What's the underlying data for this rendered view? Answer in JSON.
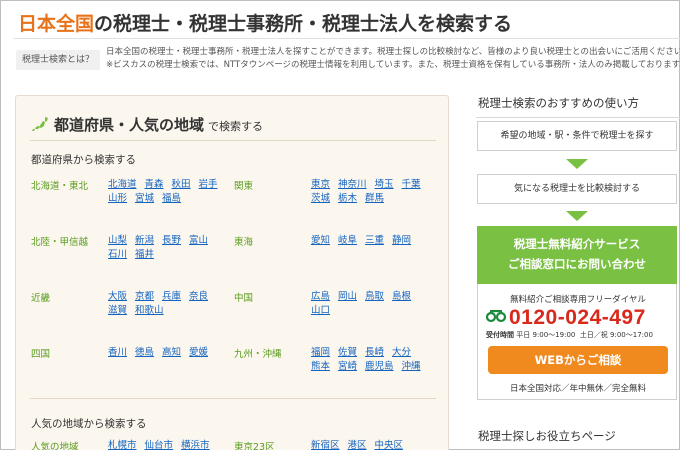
{
  "page": {
    "title_accent": "日本全国",
    "title_rest": "の税理士・税理士事務所・税理士法人を検索する"
  },
  "intro": {
    "badge": "税理士検索とは？",
    "line1": "日本全国の税理士・税理士事務所・税理士法人を探すことができます。税理士探しの比較検討など、皆様のより良い税理士との出会いにご活用くださいませ。",
    "line2": "※ビスカスの税理士検索では、NTTタウンページの税理士情報を利用しています。また、税理士資格を保有している事務所・法人のみ掲載しております。"
  },
  "search": {
    "title": "都道府県・人気の地域",
    "title_suffix": "で検索する",
    "pref_heading": "都道府県から検索する",
    "popular_heading": "人気の地域から検索する",
    "regions": [
      {
        "left_name": "北海道・東北",
        "left_prefs": [
          "北海道",
          "青森",
          "秋田",
          "岩手",
          "山形",
          "宮城",
          "福島"
        ],
        "right_name": "関東",
        "right_prefs": [
          "東京",
          "神奈川",
          "埼玉",
          "千葉",
          "茨城",
          "栃木",
          "群馬"
        ]
      },
      {
        "left_name": "北陸・甲信越",
        "left_prefs": [
          "山梨",
          "新潟",
          "長野",
          "富山",
          "石川",
          "福井"
        ],
        "right_name": "東海",
        "right_prefs": [
          "愛知",
          "岐阜",
          "三重",
          "静岡"
        ]
      },
      {
        "left_name": "近畿",
        "left_prefs": [
          "大阪",
          "京都",
          "兵庫",
          "奈良",
          "滋賀",
          "和歌山"
        ],
        "right_name": "中国",
        "right_prefs": [
          "広島",
          "岡山",
          "鳥取",
          "島根",
          "山口"
        ]
      },
      {
        "left_name": "四国",
        "left_prefs": [
          "香川",
          "徳島",
          "高知",
          "愛媛"
        ],
        "right_name": "九州・沖縄",
        "right_prefs": [
          "福岡",
          "佐賀",
          "長崎",
          "大分",
          "熊本",
          "宮崎",
          "鹿児島",
          "沖縄"
        ]
      }
    ],
    "popular": {
      "left_name": "人気の地域",
      "left_links": [
        "札幌市",
        "仙台市",
        "横浜市"
      ],
      "right_name": "東京23区",
      "right_links": [
        "新宿区",
        "港区",
        "中央区"
      ]
    }
  },
  "sidebar": {
    "howto_title": "税理士検索のおすすめの使い方",
    "step1": "希望の地域・駅・条件で税理士を探す",
    "step2": "気になる税理士を比較検討する",
    "service_line1": "税理士無料紹介サービス",
    "service_line2": "ご相談窓口にお問い合わせ",
    "free_dial_label": "無料紹介ご相談専用フリーダイヤル",
    "phone": "0120-024-497",
    "hours_label": "受付時間",
    "hours_weekday": "平日 9:00〜19:00",
    "hours_weekend": "土日／祝 9:00〜17:00",
    "web_button": "WEBからご相談",
    "support_text": "日本全国対応／年中無休／完全無料",
    "useful_title": "税理士探しお役立ちページ"
  },
  "colors": {
    "accent_orange": "#e8731a",
    "green": "#7ac143",
    "link_blue": "#1565c0",
    "phone_red": "#d9281c",
    "button_orange": "#f08a1f"
  }
}
